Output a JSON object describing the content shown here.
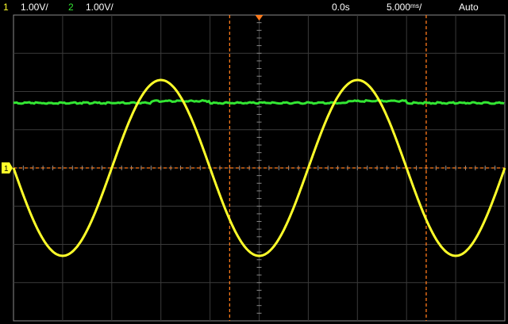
{
  "status": {
    "ch1_number": "1",
    "ch1_scale": "1.00V/",
    "ch2_number": "2",
    "ch2_scale": "1.00V/",
    "delay": "0.0s",
    "timebase": "5.000ᵐˢ/",
    "trigger_mode": "Auto"
  },
  "colors": {
    "background": "#000000",
    "grid": "#3a3a3a",
    "frame": "#8a8a8a",
    "ch1": "#ffff2a",
    "ch2": "#33e633",
    "cursor": "#ff7a1a",
    "text": "#ffffff"
  },
  "icons": {
    "trigger_position": "orange-down-triangle",
    "ch1_ground_marker": "ground-1-icon",
    "trigger_level_marker": "trigger-T-icon"
  },
  "traces": {
    "ch1": {
      "waveform": "sine",
      "amplitude_div": 2.3,
      "period_div": 4.0,
      "phase_start": "falling zero-crossing"
    },
    "ch2": {
      "waveform": "dc with small step",
      "level_div": 1.7,
      "step_div": 0.05
    }
  },
  "cursors": {
    "vertical_divisions": [
      4.4,
      8.4
    ],
    "horizontal_division": 0
  }
}
